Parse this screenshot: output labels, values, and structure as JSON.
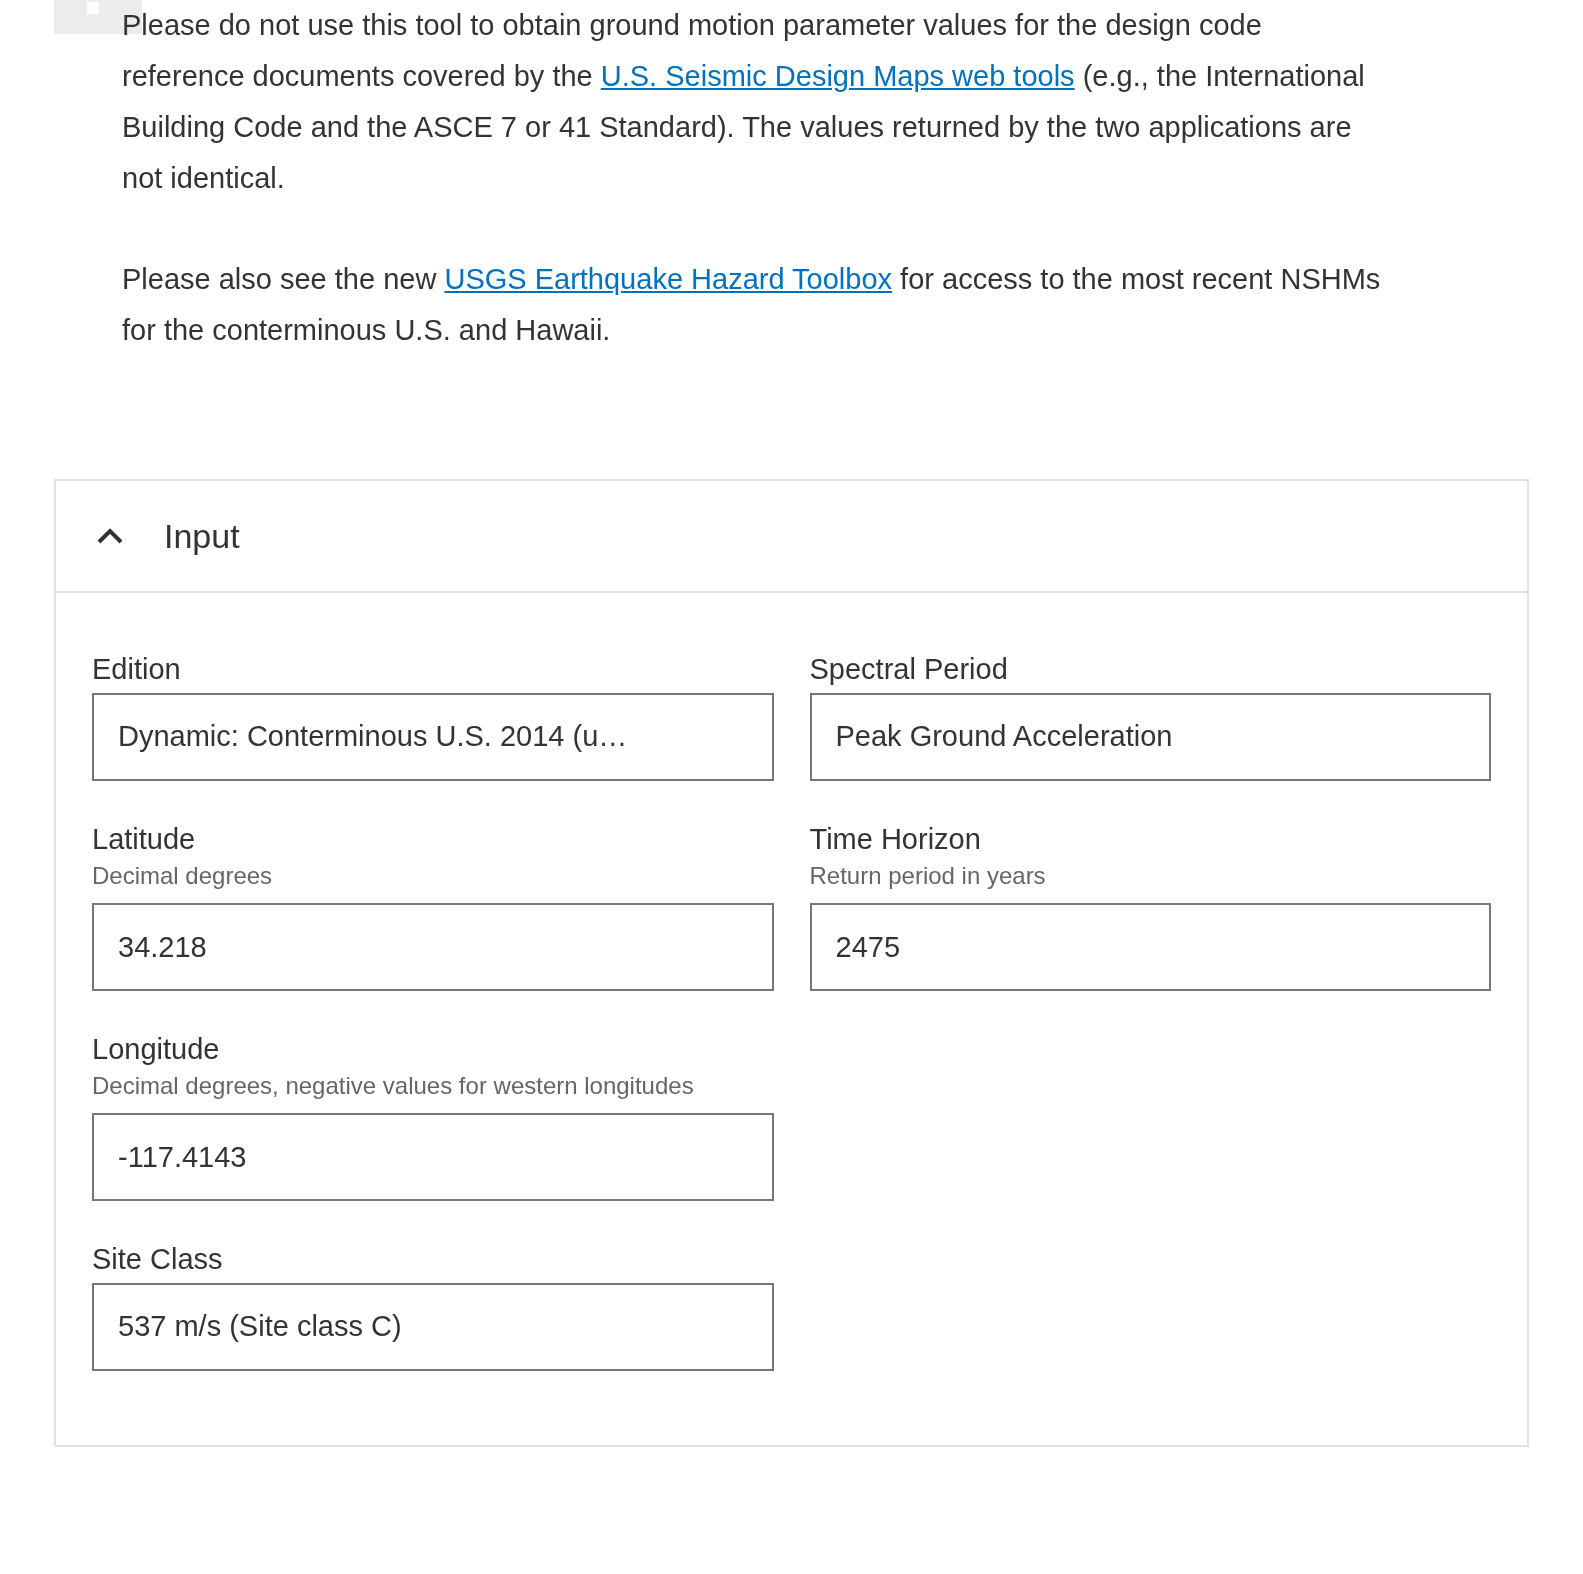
{
  "notes": [
    {
      "bullet": true,
      "segments": [
        {
          "kind": "text",
          "text": "Please do not use this tool to obtain ground motion parameter values for the design code reference documents covered by the "
        },
        {
          "kind": "link",
          "text": "U.S. Seismic Design Maps web tools"
        },
        {
          "kind": "text",
          "text": " (e.g., the International Building Code and the ASCE 7 or 41 Standard). The values returned by the two applications are not identical."
        }
      ]
    },
    {
      "bullet": false,
      "segments": [
        {
          "kind": "text",
          "text": "Please also see the new "
        },
        {
          "kind": "link",
          "text": "USGS Earthquake Hazard Toolbox"
        },
        {
          "kind": "text",
          "text": " for access to the most recent NSHMs for the conterminous U.S. and Hawaii."
        }
      ]
    }
  ],
  "panel": {
    "title": "Input",
    "expanded": true,
    "columns": [
      [
        {
          "kind": "select",
          "label": "Edition",
          "value": "Dynamic: Conterminous U.S. 2014 (u…"
        },
        {
          "kind": "input",
          "label": "Latitude",
          "hint": "Decimal degrees",
          "value": "34.218"
        },
        {
          "kind": "input",
          "label": "Longitude",
          "hint": "Decimal degrees, negative values for western longitudes",
          "value": "-117.4143"
        },
        {
          "kind": "select",
          "label": "Site Class",
          "value": "537 m/s (Site class C)"
        }
      ],
      [
        {
          "kind": "select",
          "label": "Spectral Period",
          "value": "Peak Ground Acceleration"
        },
        {
          "kind": "input",
          "label": "Time Horizon",
          "hint": "Return period in years",
          "value": "2475"
        }
      ]
    ]
  }
}
